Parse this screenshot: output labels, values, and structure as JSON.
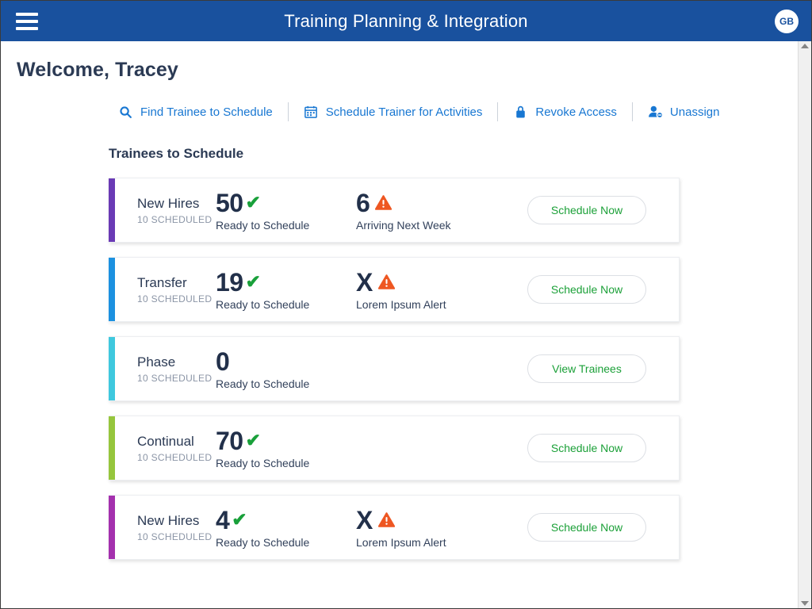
{
  "topbar": {
    "menu_icon": "hamburger-menu-icon",
    "title": "Training Planning & Integration",
    "avatar_initials": "GB",
    "bg_color": "#19519E"
  },
  "page": {
    "welcome": "Welcome, Tracey",
    "section_title": "Trainees to Schedule"
  },
  "actions": [
    {
      "label": "Find Trainee to Schedule",
      "icon": "search-icon"
    },
    {
      "label": "Schedule Trainer for Activities",
      "icon": "calendar-icon"
    },
    {
      "label": "Revoke Access",
      "icon": "lock-icon"
    },
    {
      "label": "Unassign",
      "icon": "user-remove-icon"
    }
  ],
  "cards": [
    {
      "category": "New Hires",
      "scheduled": "10 SCHEDULED",
      "accent_color": "#6A3AB5",
      "metric1": {
        "value": "50",
        "label": "Ready to Schedule",
        "status_icon": "check-icon"
      },
      "metric2": {
        "value": "6",
        "label": "Arriving Next Week",
        "status_icon": "warning-icon"
      },
      "button": "Schedule Now"
    },
    {
      "category": "Transfer",
      "scheduled": "10 SCHEDULED",
      "accent_color": "#1C91E0",
      "metric1": {
        "value": "19",
        "label": "Ready to Schedule",
        "status_icon": "check-icon"
      },
      "metric2": {
        "value": "X",
        "label": "Lorem Ipsum Alert",
        "status_icon": "warning-icon"
      },
      "button": "Schedule Now"
    },
    {
      "category": "Phase",
      "scheduled": "10 SCHEDULED",
      "accent_color": "#3FC8DE",
      "metric1": {
        "value": "0",
        "label": "Ready to Schedule",
        "status_icon": ""
      },
      "metric2": {
        "value": "",
        "label": "",
        "status_icon": ""
      },
      "button": "View Trainees"
    },
    {
      "category": "Continual",
      "scheduled": "10 SCHEDULED",
      "accent_color": "#96C match",
      "metric1": {
        "value": "70",
        "label": "Ready to Schedule",
        "status_icon": "check-icon"
      },
      "metric2": {
        "value": "",
        "label": "",
        "status_icon": ""
      },
      "button": "Schedule Now"
    },
    {
      "category": "New Hires",
      "scheduled": "10 SCHEDULED",
      "accent_color": "#A431AE",
      "metric1": {
        "value": "4",
        "label": "Ready to Schedule",
        "status_icon": "check-icon"
      },
      "metric2": {
        "value": "X",
        "label": "Lorem Ipsum Alert",
        "status_icon": "warning-icon"
      },
      "button": "Schedule Now"
    }
  ],
  "colors": {
    "accent_blue": "#1877D2",
    "heading": "#2B3A54",
    "success_green": "#19A03A",
    "warning_orange": "#EE5722",
    "button_text_green": "#1BA038"
  },
  "scrollbar": {
    "up_icon": "scroll-up-arrow-icon",
    "down_icon": "scroll-down-arrow-icon"
  }
}
